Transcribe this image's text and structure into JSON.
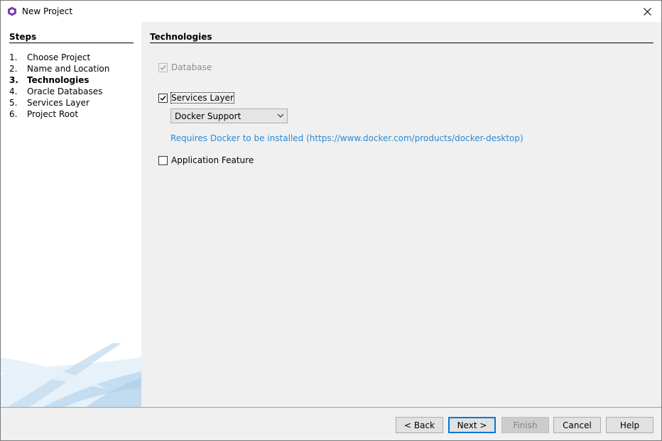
{
  "window": {
    "title": "New Project",
    "icons": {
      "app": "app-icon",
      "close": "close-icon"
    }
  },
  "steps": {
    "title": "Steps",
    "items": [
      {
        "num": "1.",
        "label": "Choose Project"
      },
      {
        "num": "2.",
        "label": "Name and Location"
      },
      {
        "num": "3.",
        "label": "Technologies"
      },
      {
        "num": "4.",
        "label": "Oracle Databases"
      },
      {
        "num": "5.",
        "label": "Services Layer"
      },
      {
        "num": "6.",
        "label": "Project Root"
      }
    ],
    "current_index": 2
  },
  "content": {
    "title": "Technologies",
    "database": {
      "label": "Database",
      "checked": true,
      "disabled": true
    },
    "services_layer": {
      "label": "Services Layer",
      "checked": true
    },
    "docker_select": {
      "value": "Docker Support"
    },
    "docker_note": "Requires Docker to be installed (https://www.docker.com/products/docker-desktop)",
    "application_feature": {
      "label": "Application Feature",
      "checked": false
    }
  },
  "buttons": {
    "back": "< Back",
    "next": "Next >",
    "finish": "Finish",
    "cancel": "Cancel",
    "help": "Help"
  },
  "colors": {
    "link": "#2a8ad4",
    "accent": "#0078d7",
    "app_icon": "#7b3fb5"
  }
}
